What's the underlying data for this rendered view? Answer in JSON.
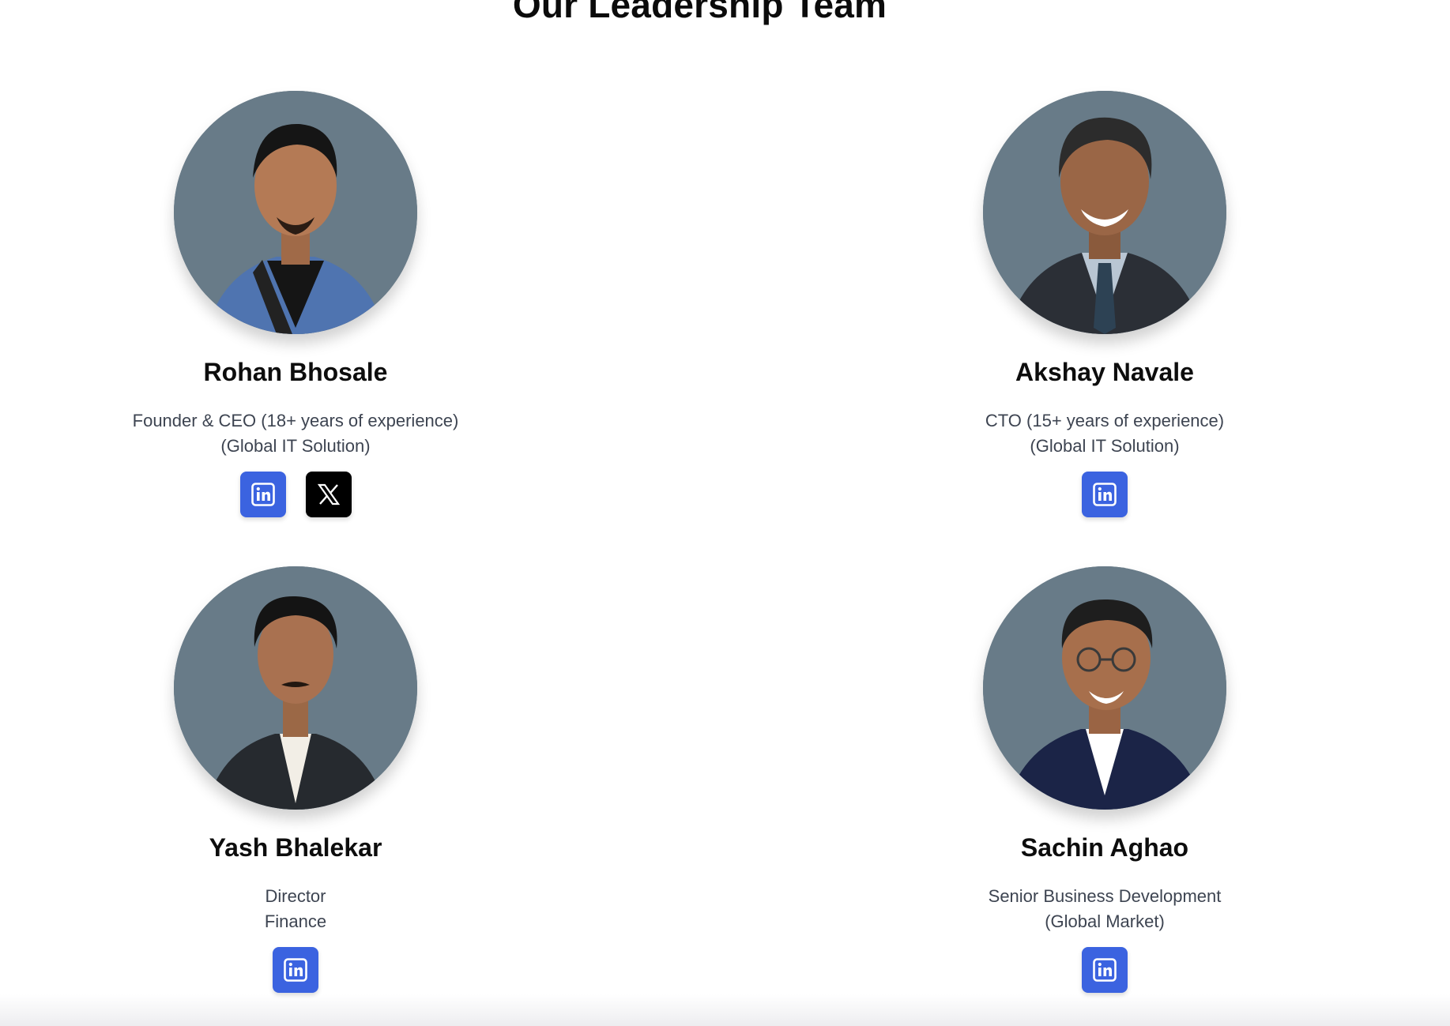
{
  "section": {
    "title": "Our Leadership Team"
  },
  "colors": {
    "linkedin": "#3b63e0",
    "x": "#000000",
    "avatar_background": "#687b88"
  },
  "members": [
    {
      "name": "Rohan Bhosale",
      "role_line1": "Founder & CEO (18+ years of experience)",
      "role_line2": "(Global IT Solution)",
      "socials": [
        "linkedin-icon",
        "x-icon"
      ]
    },
    {
      "name": "Akshay Navale",
      "role_line1": "CTO (15+ years of experience)",
      "role_line2": "(Global IT Solution)",
      "socials": [
        "linkedin-icon"
      ]
    },
    {
      "name": "Yash Bhalekar",
      "role_line1": "Director",
      "role_line2": "Finance",
      "socials": [
        "linkedin-icon"
      ]
    },
    {
      "name": "Sachin Aghao",
      "role_line1": "Senior Business Development",
      "role_line2": "(Global Market)",
      "socials": [
        "linkedin-icon"
      ]
    }
  ]
}
